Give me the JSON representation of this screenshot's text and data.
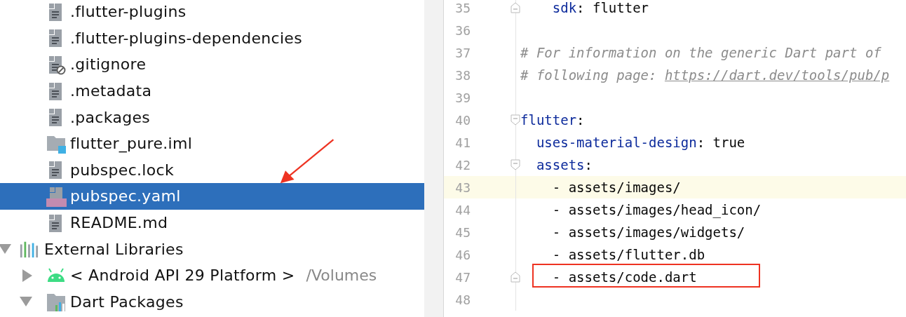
{
  "project_files": [
    {
      "label": ".flutter-plugins",
      "kind": "text",
      "selected": false
    },
    {
      "label": ".flutter-plugins-dependencies",
      "kind": "text",
      "selected": false
    },
    {
      "label": ".gitignore",
      "kind": "ignored",
      "selected": false
    },
    {
      "label": ".metadata",
      "kind": "text",
      "selected": false
    },
    {
      "label": ".packages",
      "kind": "text",
      "selected": false
    },
    {
      "label": "flutter_pure.iml",
      "kind": "module",
      "selected": false
    },
    {
      "label": "pubspec.lock",
      "kind": "text",
      "selected": false
    },
    {
      "label": "pubspec.yaml",
      "kind": "yaml",
      "selected": true
    },
    {
      "label": "README.md",
      "kind": "text",
      "selected": false
    }
  ],
  "external_libraries": {
    "label": "External Libraries",
    "expanded": true,
    "children": [
      {
        "label": "< Android API 29 Platform >",
        "path": "/Volumes",
        "kind": "android",
        "expanded": false
      },
      {
        "label": "Dart Packages",
        "kind": "package",
        "expanded": true
      }
    ]
  },
  "editor_lines": [
    {
      "number": "35",
      "fold_start": false,
      "fold_end": true,
      "current": false,
      "annotated": false,
      "tokens": [
        {
          "kind": "key",
          "text": "    sdk"
        },
        {
          "kind": "plain",
          "text": ": flutter"
        }
      ]
    },
    {
      "number": "36",
      "fold_start": false,
      "fold_end": false,
      "current": false,
      "annotated": false
    },
    {
      "number": "37",
      "fold_start": false,
      "fold_end": false,
      "current": false,
      "annotated": false,
      "tokens": [
        {
          "kind": "comment",
          "text": "# For information on the generic Dart part of"
        }
      ]
    },
    {
      "number": "38",
      "fold_start": false,
      "fold_end": false,
      "current": false,
      "annotated": false,
      "tokens": [
        {
          "kind": "comment",
          "text": "# following page: "
        },
        {
          "kind": "link",
          "text": "https://dart.dev/tools/pub/p"
        }
      ]
    },
    {
      "number": "39",
      "fold_start": false,
      "fold_end": false,
      "current": false,
      "annotated": false
    },
    {
      "number": "40",
      "fold_start": true,
      "fold_end": false,
      "current": false,
      "annotated": false,
      "tokens": [
        {
          "kind": "key",
          "text": "flutter"
        },
        {
          "kind": "plain",
          "text": ":"
        }
      ]
    },
    {
      "number": "41",
      "fold_start": false,
      "fold_end": false,
      "current": false,
      "annotated": false,
      "tokens": [
        {
          "kind": "key",
          "text": "  uses-material-design"
        },
        {
          "kind": "plain",
          "text": ": true"
        }
      ]
    },
    {
      "number": "42",
      "fold_start": true,
      "fold_end": false,
      "current": false,
      "annotated": false,
      "tokens": [
        {
          "kind": "key",
          "text": "  assets"
        },
        {
          "kind": "plain",
          "text": ":"
        }
      ]
    },
    {
      "number": "43",
      "fold_start": false,
      "fold_end": false,
      "current": true,
      "annotated": false,
      "tokens": [
        {
          "kind": "plain",
          "text": "    - assets/images/"
        }
      ]
    },
    {
      "number": "44",
      "fold_start": false,
      "fold_end": false,
      "current": false,
      "annotated": false,
      "tokens": [
        {
          "kind": "plain",
          "text": "    - assets/images/head_icon/"
        }
      ]
    },
    {
      "number": "45",
      "fold_start": false,
      "fold_end": false,
      "current": false,
      "annotated": false,
      "tokens": [
        {
          "kind": "plain",
          "text": "    - assets/images/widgets/"
        }
      ]
    },
    {
      "number": "46",
      "fold_start": false,
      "fold_end": false,
      "current": false,
      "annotated": false,
      "tokens": [
        {
          "kind": "plain",
          "text": "    - assets/flutter.db"
        }
      ]
    },
    {
      "number": "47",
      "fold_start": false,
      "fold_end": true,
      "current": false,
      "annotated": true,
      "tokens": [
        {
          "kind": "plain",
          "text": "    - assets/code.dart"
        }
      ]
    },
    {
      "number": "48",
      "fold_start": false,
      "fold_end": false,
      "current": false,
      "annotated": false
    }
  ]
}
